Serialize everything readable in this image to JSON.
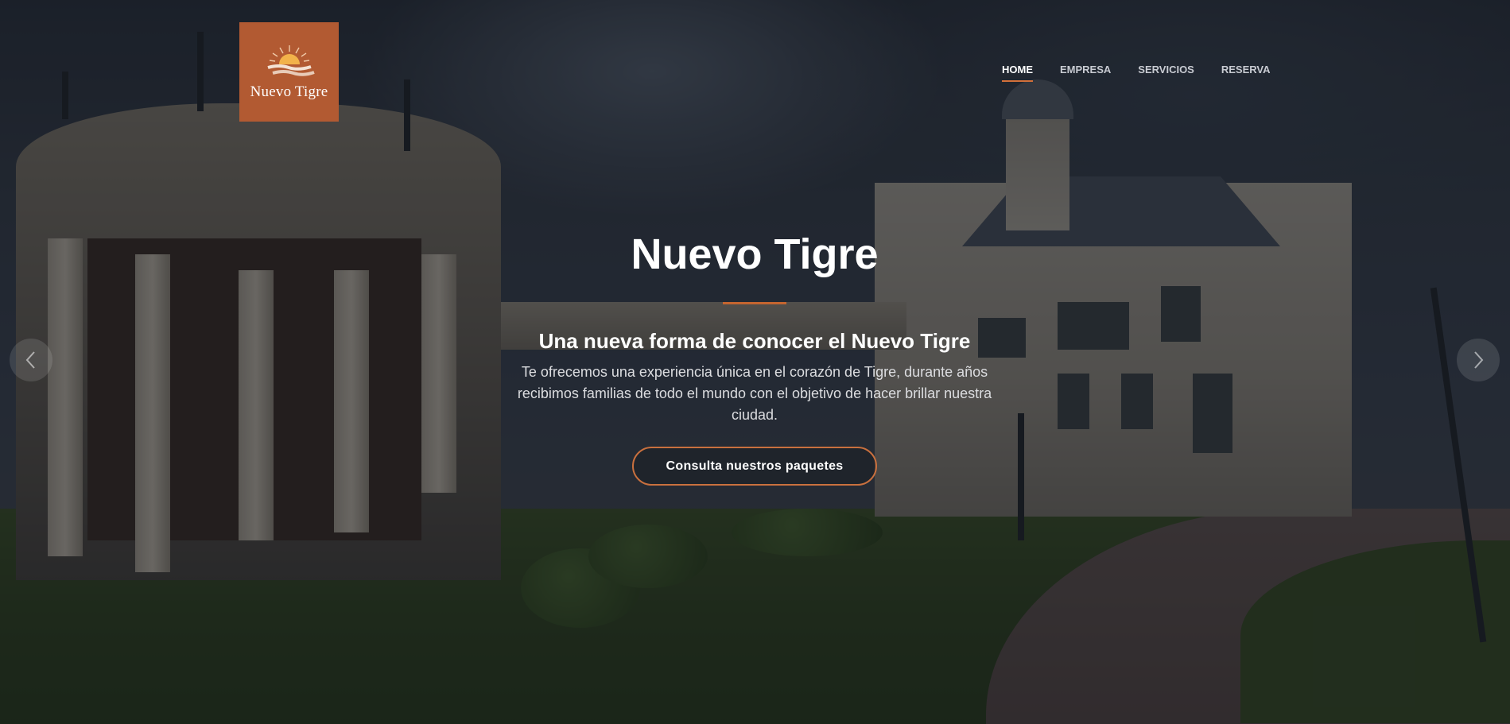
{
  "brand": {
    "logo_text": "Nuevo Tigre",
    "logo_color": "#b25a32"
  },
  "nav": {
    "items": [
      {
        "label": "HOME",
        "active": true
      },
      {
        "label": "EMPRESA",
        "active": false
      },
      {
        "label": "SERVICIOS",
        "active": false
      },
      {
        "label": "RESERVA",
        "active": false
      }
    ],
    "accent_color": "#d2703a"
  },
  "hero": {
    "title": "Nuevo Tigre",
    "subtitle": "Una nueva forma de conocer el Nuevo Tigre",
    "text": "Te ofrecemos una experiencia única en el corazón de Tigre, durante años recibimos familias de todo el mundo con el objetivo de hacer brillar nuestra ciudad.",
    "cta_label": "Consulta nuestros paquetes"
  },
  "slider": {
    "prev_icon": "chevron-left-icon",
    "next_icon": "chevron-right-icon"
  }
}
